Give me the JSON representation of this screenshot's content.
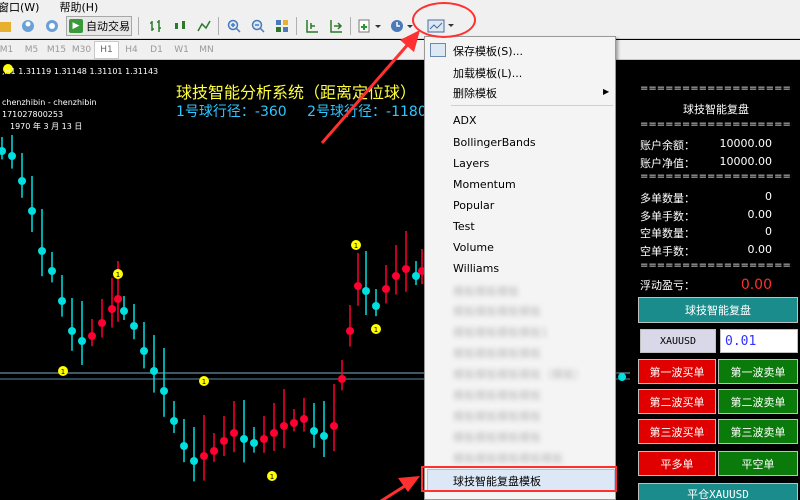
{
  "menubar": {
    "items": [
      "窗口(W)",
      "帮助(H)"
    ]
  },
  "toolbar": {
    "autotrade_label": "自动交易"
  },
  "timeframes": [
    "M1",
    "M5",
    "M15",
    "M30",
    "H1",
    "H4",
    "D1",
    "W1",
    "MN"
  ],
  "active_timeframe": "H1",
  "chart": {
    "ohlc_line": ",H1  1.31119 1.31148 1.31101 1.31143",
    "info": [
      "chenzhibin - chenzhibin",
      "171027800253",
      "1970 年 3 月 13 日"
    ],
    "title": "球技智能分析系统（距离定位球）",
    "subtitle_1": "1号球行径：-360",
    "subtitle_2": "2号球行径：-1180",
    "marker_label": "1"
  },
  "panel": {
    "separator": "========================",
    "title": "球技智能复盘",
    "balance_label": "账户余额：",
    "balance_value": "10000.00",
    "equity_label": "账户净值：",
    "equity_value": "10000.00",
    "buy_count_label": "多单数量：",
    "buy_count_value": "0",
    "buy_lots_label": "多单手数：",
    "buy_lots_value": "0.00",
    "sell_count_label": "空单数量：",
    "sell_count_value": "0",
    "sell_lots_label": "空单手数：",
    "sell_lots_value": "0.00",
    "pnl_label": "浮动盈亏：",
    "pnl_value": "0.00",
    "replay_button": "球技智能复盘",
    "symbol": "XAUUSD",
    "lot": "0.01",
    "buy1": "第一波买单",
    "sell1": "第一波卖单",
    "buy2": "第二波买单",
    "sell2": "第二波卖单",
    "buy3": "第三波买单",
    "sell3": "第三波卖单",
    "close_buy": "平多单",
    "close_sell": "平空单",
    "close_symbol": "平仓XAUUSD"
  },
  "menu": {
    "save": "保存模板(S)...",
    "load": "加载模板(L)...",
    "delete": "删除模板",
    "templates": [
      "ADX",
      "BollingerBands",
      "Layers",
      "Momentum",
      "Popular",
      "Test",
      "Volume",
      "Williams"
    ],
    "blurred": [
      "模板模板模板",
      "模板模板模板模板",
      "模板模板模板模板1",
      "模板模板模板模板",
      "模板模板模板模板（模板）",
      "模板模板模板模板",
      "模板模板模板模板",
      "模板模板模板模板",
      "模板模板模板模板模板"
    ],
    "last": "球技智能复盘模板"
  },
  "colors": {
    "up": "#ff0030",
    "down": "#00e0e0",
    "bg": "#000000",
    "accent": "#ff3030"
  }
}
